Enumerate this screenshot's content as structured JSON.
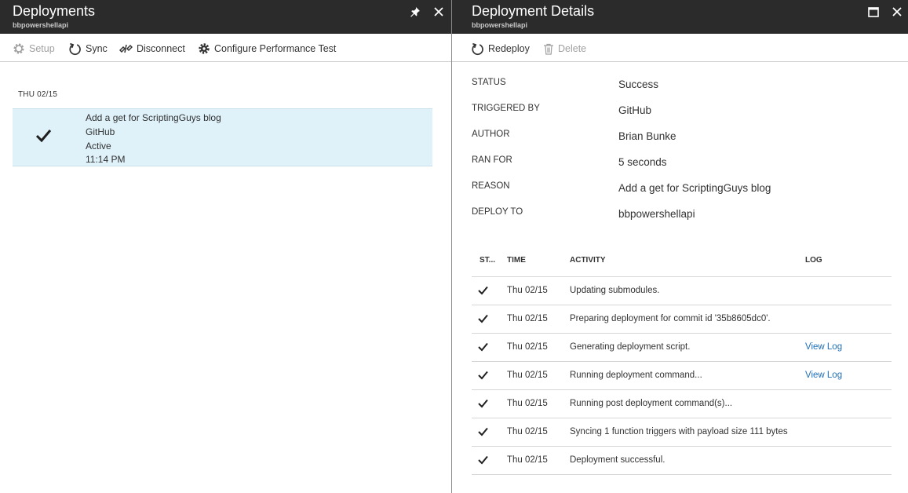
{
  "left": {
    "title": "Deployments",
    "subtitle": "bbpowershellapi",
    "toolbar": {
      "setup": "Setup",
      "sync": "Sync",
      "disconnect": "Disconnect",
      "configure": "Configure Performance Test"
    },
    "date_group": "THU 02/15",
    "deployment": {
      "message": "Add a get for ScriptingGuys blog",
      "source": "GitHub",
      "state": "Active",
      "time": "11:14 PM"
    }
  },
  "right": {
    "title": "Deployment Details",
    "subtitle": "bbpowershellapi",
    "toolbar": {
      "redeploy": "Redeploy",
      "delete": "Delete"
    },
    "details": [
      {
        "label": "STATUS",
        "value": "Success"
      },
      {
        "label": "TRIGGERED BY",
        "value": "GitHub"
      },
      {
        "label": "AUTHOR",
        "value": "Brian Bunke"
      },
      {
        "label": "RAN FOR",
        "value": "5 seconds"
      },
      {
        "label": "REASON",
        "value": "Add a get for ScriptingGuys blog"
      },
      {
        "label": "DEPLOY TO",
        "value": "bbpowershellapi"
      }
    ],
    "activity_columns": {
      "status": "ST...",
      "time": "TIME",
      "activity": "ACTIVITY",
      "log": "LOG"
    },
    "activity": [
      {
        "time": "Thu 02/15",
        "activity": "Updating submodules.",
        "log": ""
      },
      {
        "time": "Thu 02/15",
        "activity": "Preparing deployment for commit id '35b8605dc0'.",
        "log": ""
      },
      {
        "time": "Thu 02/15",
        "activity": "Generating deployment script.",
        "log": "View Log"
      },
      {
        "time": "Thu 02/15",
        "activity": "Running deployment command...",
        "log": "View Log"
      },
      {
        "time": "Thu 02/15",
        "activity": "Running post deployment command(s)...",
        "log": ""
      },
      {
        "time": "Thu 02/15",
        "activity": "Syncing 1 function triggers with payload size 111 bytes",
        "log": ""
      },
      {
        "time": "Thu 02/15",
        "activity": "Deployment successful.",
        "log": ""
      }
    ]
  },
  "colors": {
    "header_bg": "#2b2b2b",
    "selected_row_bg": "#dff2fa",
    "link": "#1d6fb8",
    "disabled_text": "#a0a0a0"
  },
  "icons": [
    "pin-icon",
    "close-icon",
    "maximize-icon",
    "gear-icon",
    "sync-icon",
    "disconnect-icon",
    "redeploy-icon",
    "trash-icon",
    "checkmark-icon"
  ]
}
